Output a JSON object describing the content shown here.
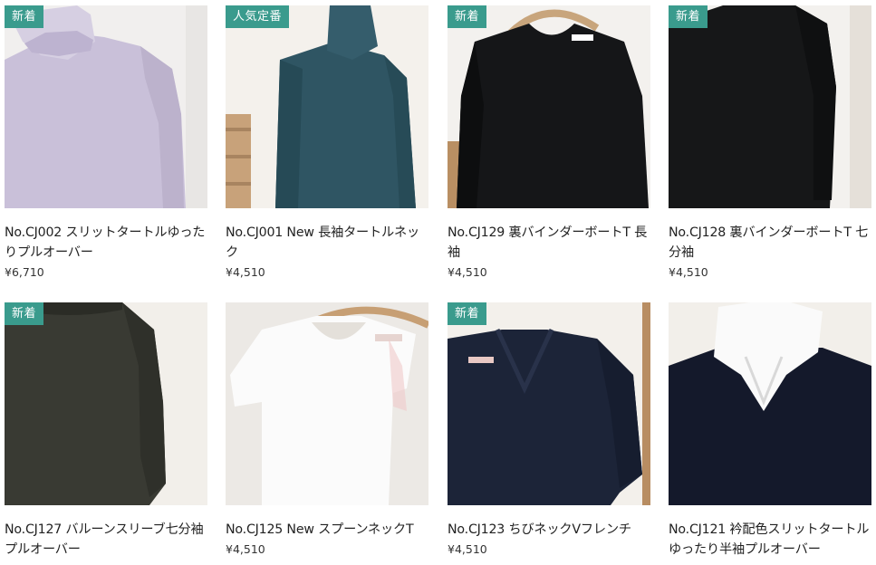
{
  "colors": {
    "badge_bg": "#3a9b8d"
  },
  "products": [
    {
      "name": "No.CJ002 スリットタートルゆったりプルオーバー",
      "price": "¥6,710",
      "badge": "新着",
      "garment": "lavender-turtleneck"
    },
    {
      "name": "No.CJ001 New 長袖タートルネック",
      "price": "¥4,510",
      "badge": "人気定番",
      "garment": "teal-turtleneck"
    },
    {
      "name": "No.CJ129 裏バインダーボートT 長袖",
      "price": "¥4,510",
      "badge": "新着",
      "garment": "black-longsleeve-hanger"
    },
    {
      "name": "No.CJ128 裏バインダーボートT 七分袖",
      "price": "¥4,510",
      "badge": "新着",
      "garment": "black-threequarter"
    },
    {
      "name": "No.CJ127 バルーンスリーブ七分袖プルオーバー",
      "price": "",
      "badge": "新着",
      "garment": "olive-balloon"
    },
    {
      "name": "No.CJ125 New スプーンネックT",
      "price": "¥4,510",
      "badge": "",
      "garment": "white-tee-hanger"
    },
    {
      "name": "No.CJ123 ちびネックVフレンチ",
      "price": "¥4,510",
      "badge": "新着",
      "garment": "navy-vneck"
    },
    {
      "name": "No.CJ121 衿配色スリットタートルゆったり半袖プルオーバー",
      "price": "",
      "badge": "",
      "garment": "navy-white-collar"
    }
  ]
}
